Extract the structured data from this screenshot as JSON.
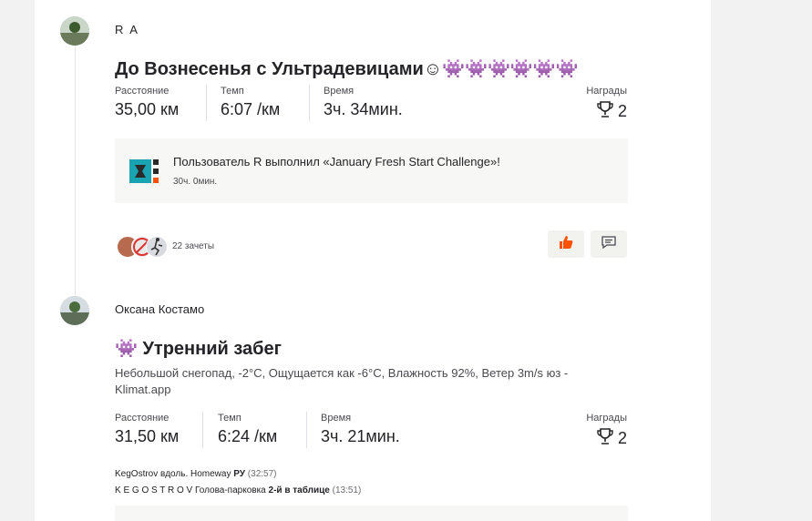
{
  "feed": [
    {
      "athlete": "R A",
      "title": "До Вознесенья с Ультрадевицами☺👾👾👾👾👾👾",
      "stats": [
        {
          "label": "Расстояние",
          "value": "35,00 км"
        },
        {
          "label": "Темп",
          "value": "6:07 /км"
        },
        {
          "label": "Время",
          "value": "3ч. 34мин."
        }
      ],
      "awards_label": "Награды",
      "awards_count": "2",
      "challenge_text": "Пользователь R выполнил «January Fresh Start Challenge»!",
      "challenge_time": "30ч. 0мин.",
      "kudos_text": "22 зачеты"
    },
    {
      "athlete": "Оксана Костамо",
      "title": "👾 Утренний забег",
      "description": "Небольшой снегопад, -2°C, Ощущается как -6°C, Влажность 92%, Ветер 3m/s юз - Klimat.app",
      "stats": [
        {
          "label": "Расстояние",
          "value": "31,50 км"
        },
        {
          "label": "Темп",
          "value": "6:24 /км"
        },
        {
          "label": "Время",
          "value": "3ч. 21мин."
        }
      ],
      "awards_label": "Награды",
      "awards_count": "2",
      "segments": [
        {
          "name": "KegOstrov вдоль. Homeway",
          "achievement": "РУ",
          "time": "(32:57)"
        },
        {
          "name": "K E G O S T R O V Голова-парковка",
          "achievement": "2-й в таблице",
          "time": "(13:51)"
        }
      ]
    }
  ],
  "colors": {
    "accent": "#fc5200",
    "background": "#f2f2f2",
    "card": "#ffffff"
  },
  "icons": {
    "trophy": "trophy-icon",
    "kudos": "thumbs-up-icon",
    "comment": "comment-icon"
  }
}
